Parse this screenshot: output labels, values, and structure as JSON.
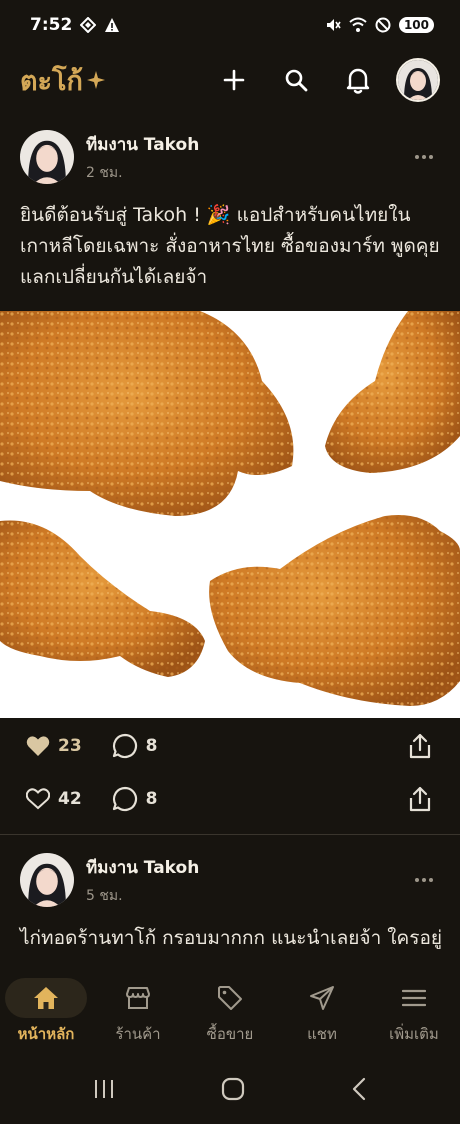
{
  "status_bar": {
    "time": "7:52",
    "battery": "100"
  },
  "header": {
    "logo": "ตะโก้",
    "icons": [
      "plus-icon",
      "search-icon",
      "bell-icon"
    ]
  },
  "posts": [
    {
      "author": "ทีมงาน Takoh",
      "time": "2 ชม.",
      "text": "ยินดีต้อนรับสู่ Takoh ! 🎉 แอปสำหรับคนไทยในเกาหลีโดยเฉพาะ สั่งอาหารไทย ซื้อของมาร์ท พูดคุยแลกเปลี่ยนกันได้เลยจ้า",
      "actions": [
        {
          "likes": "23",
          "comments": "8",
          "liked": true
        },
        {
          "likes": "42",
          "comments": "8",
          "liked": false
        }
      ]
    },
    {
      "author": "ทีมงาน Takoh",
      "time": "5 ชม.",
      "text": "ไก่ทอดร้านทาโก้ กรอบมากกก แนะนำเลยจ้า ใครอยู่"
    }
  ],
  "bottom_nav": [
    {
      "label": "หน้าหลัก",
      "icon": "home-icon",
      "active": true
    },
    {
      "label": "ร้านค้า",
      "icon": "store-icon",
      "active": false
    },
    {
      "label": "ซื้อขาย",
      "icon": "tag-icon",
      "active": false
    },
    {
      "label": "แชท",
      "icon": "send-icon",
      "active": false
    },
    {
      "label": "เพิ่มเติม",
      "icon": "menu-icon",
      "active": false
    }
  ],
  "colors": {
    "background": "#17140f",
    "accent": "#d4a857",
    "image_bg": "#ffffff"
  }
}
